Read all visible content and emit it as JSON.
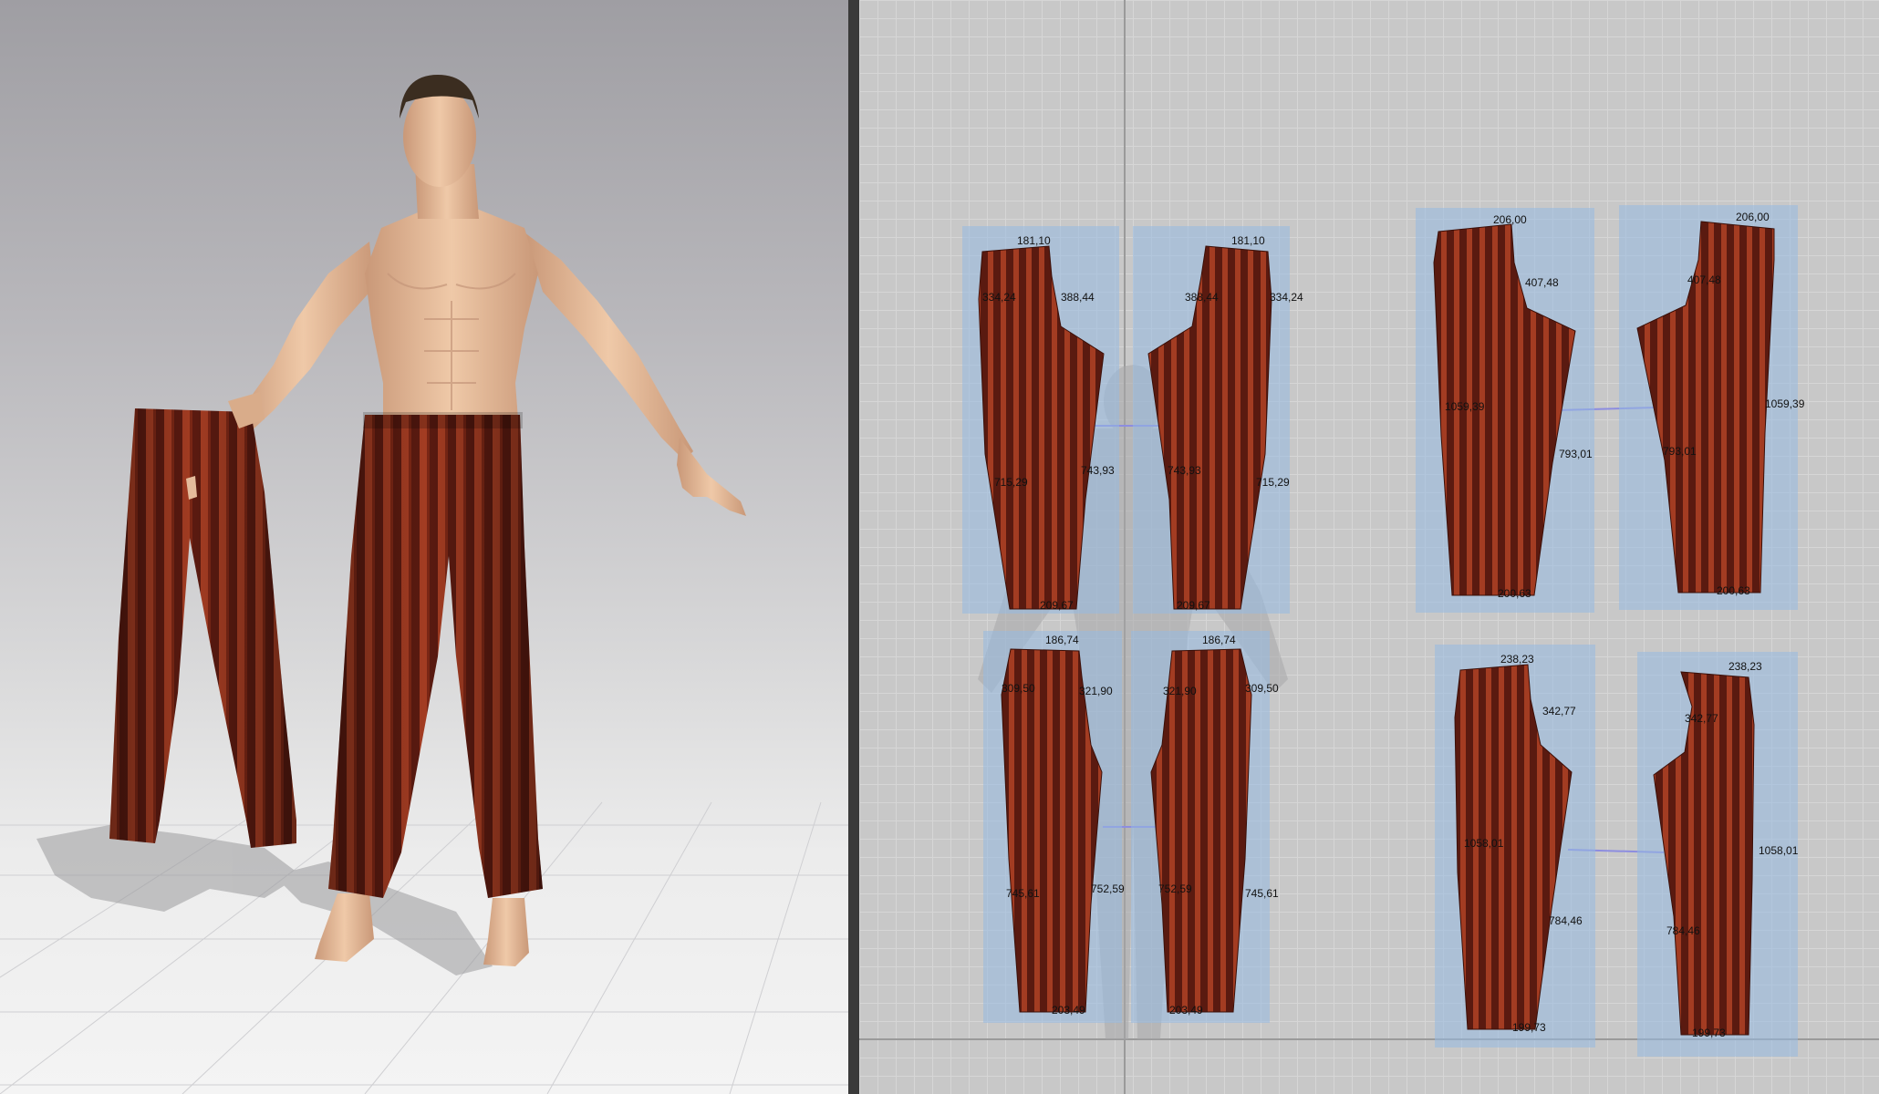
{
  "colors": {
    "fabric_base": "#5a1a10",
    "fabric_stripe": "#a33c22",
    "piece_bg": "#96b9e1",
    "skin": "#e4bc9c"
  },
  "pattern_pieces": [
    {
      "id": "front-upper-left",
      "labels": [
        "181,10",
        "334,24",
        "388,44",
        "715,29",
        "743,93",
        "209,67"
      ]
    },
    {
      "id": "front-upper-right",
      "labels": [
        "181,10",
        "388,44",
        "334,24",
        "743,93",
        "715,29",
        "209,67"
      ]
    },
    {
      "id": "front-lower-left",
      "labels": [
        "186,74",
        "309,50",
        "321,90",
        "745,61",
        "752,59",
        "203,49"
      ]
    },
    {
      "id": "front-lower-right",
      "labels": [
        "186,74",
        "321,90",
        "309,50",
        "752,59",
        "745,61",
        "203,49"
      ]
    },
    {
      "id": "back-upper-left",
      "labels": [
        "206,00",
        "407,48",
        "1059,39",
        "793,01",
        "200,63"
      ]
    },
    {
      "id": "back-upper-right",
      "labels": [
        "206,00",
        "407,48",
        "1059,39",
        "793,01",
        "200,63"
      ]
    },
    {
      "id": "back-lower-left",
      "labels": [
        "238,23",
        "342,77",
        "1058,01",
        "784,46",
        "199,73"
      ]
    },
    {
      "id": "back-lower-right",
      "labels": [
        "238,23",
        "342,77",
        "1058,01",
        "784,46",
        "199,73"
      ]
    }
  ]
}
